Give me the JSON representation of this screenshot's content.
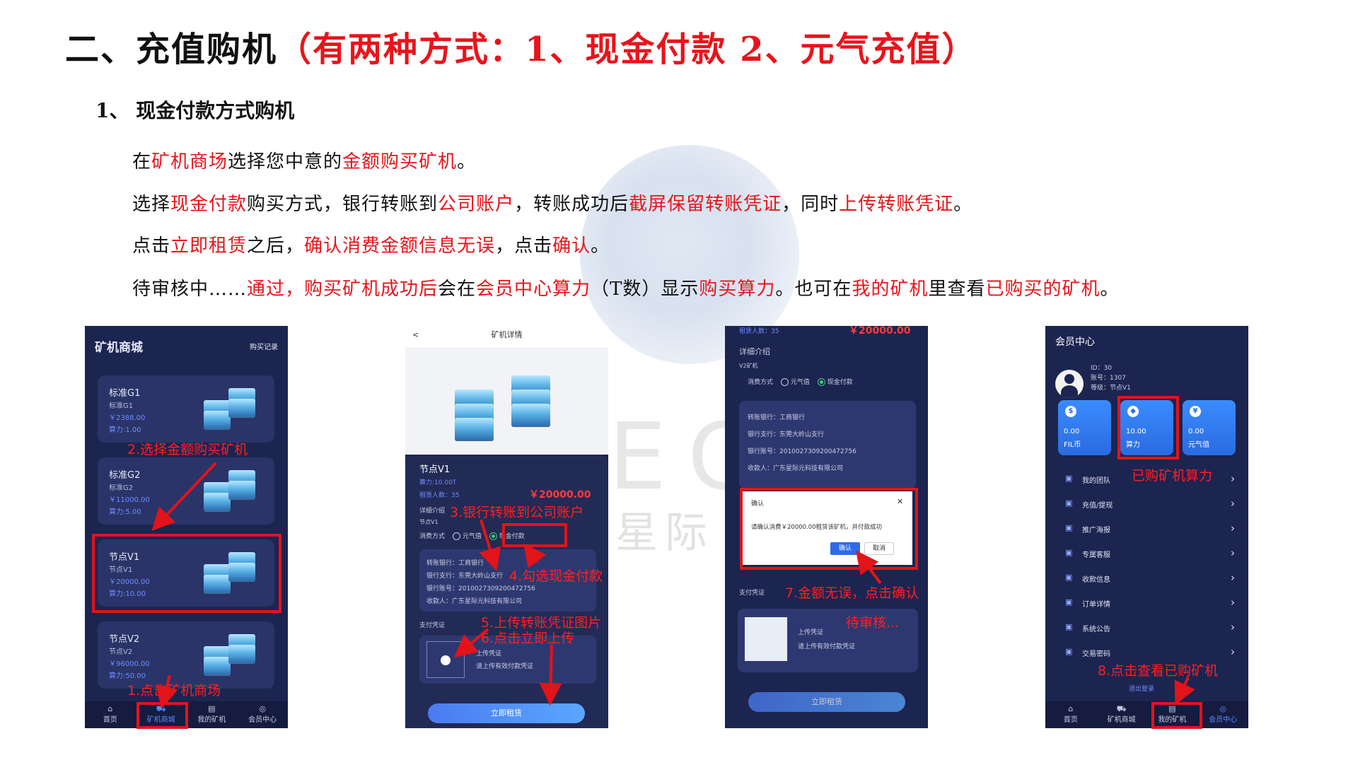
{
  "heading": {
    "main": "二、充值购机",
    "paren": "（有两种方式：1、现金付款  2、元气充值）"
  },
  "subheading": "1、  现金付款方式购机",
  "paragraphs": {
    "p1": {
      "a": "在",
      "b": "矿机商场",
      "c": "选择您中意的",
      "d": "金额购买矿机",
      "e": "。"
    },
    "p2": {
      "a": "选择",
      "b": "现金付款",
      "c": "购买方式，银行转账到",
      "d": "公司账户",
      "e": "，转账成功后",
      "f": "截屏保留转账凭证",
      "g": "，同时",
      "h": "上传转账凭证",
      "i": "。"
    },
    "p3": {
      "a": "点击",
      "b": "立即租赁",
      "c": "之后，",
      "d": "确认消费金额信息无误",
      "e": "，点击",
      "f": "确认",
      "g": "。"
    },
    "p4": {
      "a": "待审核中……",
      "b": "通过，购买矿机成功后",
      "c": "会在",
      "d": "会员中心算力",
      "e": "（T数）显示",
      "f": "购买算力",
      "g": "。也可在",
      "h": "我的矿机",
      "i": "里查看",
      "j": "已购买的矿机",
      "k": "。"
    }
  },
  "watermark": {
    "latin": "ECON",
    "cn": "星际"
  },
  "phone1": {
    "title": "矿机商城",
    "record": "购买记录",
    "cards": [
      {
        "name": "标准G1",
        "sub": "标准G1",
        "price": "￥2388.00",
        "power": "算力:1.00"
      },
      {
        "name": "标准G2",
        "sub": "标准G2",
        "price": "￥11000.00",
        "power": "算力:5.00"
      },
      {
        "name": "节点V1",
        "sub": "节点V1",
        "price": "￥20000.00",
        "power": "算力:10.00"
      },
      {
        "name": "节点V2",
        "sub": "节点V2",
        "price": "￥96000.00",
        "power": "算力:50.00"
      }
    ],
    "tabs": [
      "首页",
      "矿机商城",
      "我的矿机",
      "会员中心"
    ],
    "ann_select": "2.选择金额购买矿机",
    "ann_click": "1.点击矿机商场"
  },
  "phone2": {
    "header": "矿机详情",
    "back": "<",
    "name": "节点V1",
    "power": "算力:10.00T",
    "renters": "租赁人数：35",
    "price": "￥20000.00",
    "detail": "详细介绍",
    "sub": "节点V1",
    "pay_label": "消费方式",
    "opt1": "元气值",
    "opt2": "现金付款",
    "bank": [
      "转账银行：工商银行",
      "银行支行：东莞大岭山支行",
      "银行账号：2010027309200472756",
      "收款人：广东星际元科技有限公司"
    ],
    "voucher": "支付凭证",
    "upload_t": "上传凭证",
    "upload_s": "请上传有效付款凭证",
    "button": "立即租赁",
    "ann3": "3.银行转账到公司账户",
    "ann4": "4.勾选现金付款",
    "ann5": "5.上传转账凭证图片",
    "ann6": "6.点击立即上传"
  },
  "phone3": {
    "renters": "租赁人数：35",
    "price": "￥20000.00",
    "detail": "详细介绍",
    "sub": "V2矿机",
    "pay_label": "消费方式",
    "opt1": "元气值",
    "opt2": "现金付款",
    "bank": [
      "转账银行：工商银行",
      "银行支行：东莞大岭山支行",
      "银行账号：2010027309200472756",
      "收款人：广东星际元科技有限公司"
    ],
    "dialog_title": "确认",
    "dialog_close": "✕",
    "dialog_msg": "请确认消费￥20000.00租赁该矿机，并付款成功",
    "ok": "确认",
    "cancel": "取消",
    "voucher": "支付凭证",
    "upload_t": "上传凭证",
    "upload_s": "请上传有效付款凭证",
    "button": "立即租赁",
    "ann7": "7.金额无误，点击确认",
    "pending": "待审核..."
  },
  "phone4": {
    "title": "会员中心",
    "id": "ID：30",
    "account": "账号：1307",
    "level": "等级：节点V1",
    "tiles": [
      {
        "icon": "$",
        "value": "0.00",
        "label": "FIL币"
      },
      {
        "icon": "◆",
        "value": "10.00",
        "label": "算力"
      },
      {
        "icon": "¥",
        "value": "0.00",
        "label": "元气值"
      }
    ],
    "menu": [
      "我的团队",
      "充值/提现",
      "推广海报",
      "专属客服",
      "收款信息",
      "订单详情",
      "系统公告",
      "交易密码"
    ],
    "logout": "退出登录",
    "tabs": [
      "首页",
      "矿机商城",
      "我的矿机",
      "会员中心"
    ],
    "ann_power": "已购矿机算力",
    "ann8": "8.点击查看已购矿机"
  },
  "colors": {
    "accent_red": "#e8141b",
    "phone_bg": "#1c2450",
    "card_bg": "#2a3468",
    "tile_blue": "#3a8cff"
  }
}
